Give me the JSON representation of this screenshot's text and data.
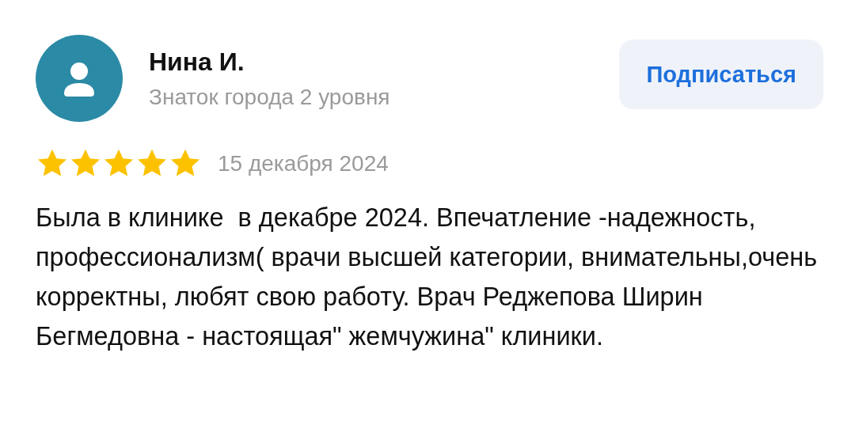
{
  "author": {
    "name": "Нина И.",
    "level": "Знаток города 2 уровня"
  },
  "subscribe_button": "Подписаться",
  "rating": {
    "stars": 5,
    "date": "15 декабря 2024"
  },
  "review_text": "Была в клинике  в декабре 2024. Впечатление -надежность, профессионализм( врачи высшей категории, внимательны,очень корректны, любят свою работу. Врач Реджепова Ширин Бегмедовна - настоящая\" жемчужина\" клиники."
}
